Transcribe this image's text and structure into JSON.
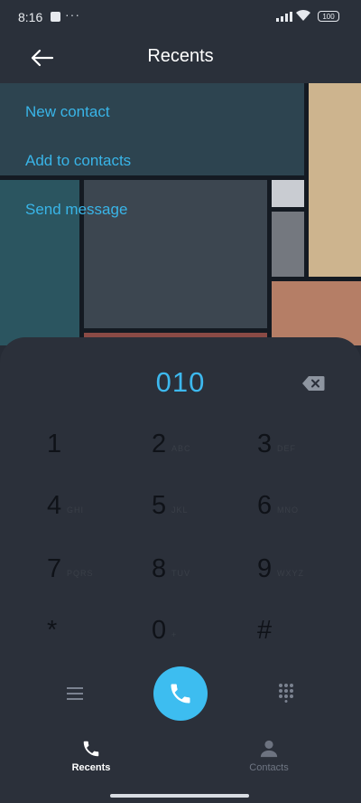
{
  "status": {
    "time": "8:16",
    "dots": "···",
    "battery": "100"
  },
  "header": {
    "title": "Recents"
  },
  "menu": {
    "items": [
      "New contact",
      "Add to contacts",
      "Send message"
    ]
  },
  "dialer": {
    "number": "010",
    "keys": [
      {
        "digit": "1",
        "line1": "",
        "line2": ""
      },
      {
        "digit": "2",
        "line1": "",
        "line2": "ABC"
      },
      {
        "digit": "3",
        "line1": "",
        "line2": "DEF"
      },
      {
        "digit": "4",
        "line1": "",
        "line2": "GHI"
      },
      {
        "digit": "5",
        "line1": "",
        "line2": "JKL"
      },
      {
        "digit": "6",
        "line1": "",
        "line2": "MNO"
      },
      {
        "digit": "7",
        "line1": "",
        "line2": "PQRS"
      },
      {
        "digit": "8",
        "line1": "",
        "line2": "TUV"
      },
      {
        "digit": "9",
        "line1": "",
        "line2": "WXYZ"
      },
      {
        "digit": "*",
        "line1": "",
        "line2": ""
      },
      {
        "digit": "0",
        "line1": "",
        "line2": "+"
      },
      {
        "digit": "#",
        "line1": "",
        "line2": ""
      }
    ]
  },
  "nav": {
    "recents": "Recents",
    "contacts": "Contacts"
  },
  "colors": {
    "accent": "#3dbdf0",
    "background": "#262b35",
    "sheet": "#2b303a"
  },
  "icons": [
    "back-arrow-icon",
    "backspace-icon",
    "menu-lines-icon",
    "phone-icon",
    "dialpad-icon",
    "person-icon"
  ]
}
